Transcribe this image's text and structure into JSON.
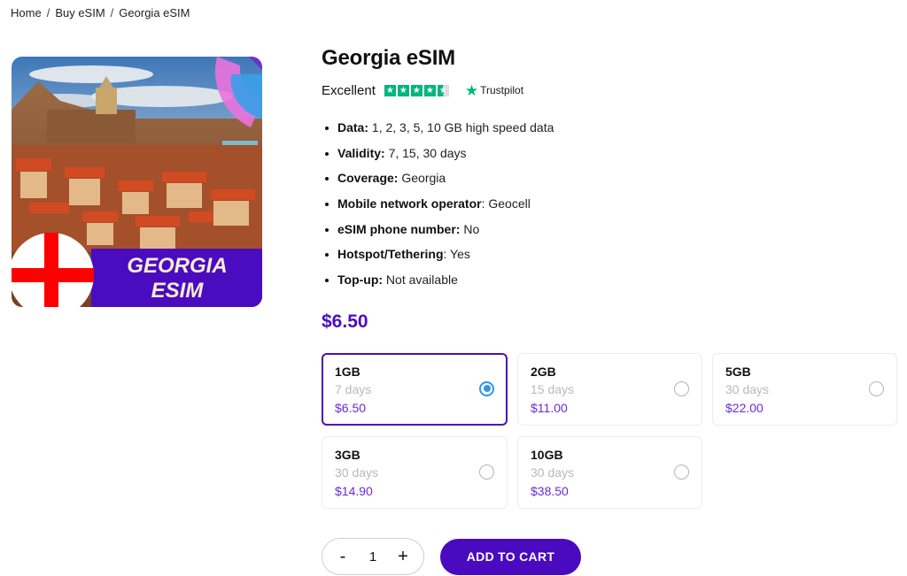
{
  "breadcrumb": {
    "items": [
      "Home",
      "Buy eSIM",
      "Georgia eSIM"
    ],
    "separator": "/"
  },
  "product_image": {
    "alt": "Georgia eSIM",
    "banner_line1": "GEORGIA",
    "banner_line2": "ESIM"
  },
  "product": {
    "title": "Georgia eSIM",
    "rating": {
      "label": "Excellent",
      "stars": 4.5,
      "max_stars": 5,
      "provider": "Trustpilot",
      "provider_icon": "star-icon",
      "color": "#00b67a"
    },
    "features": [
      {
        "label": "Data:",
        "value": " 1, 2, 3, 5, 10 GB high speed data"
      },
      {
        "label": "Validity:",
        "value": " 7, 15, 30 days"
      },
      {
        "label": "Coverage:",
        "value": " Georgia"
      },
      {
        "label": "Mobile network operator",
        "value": ": Geocell"
      },
      {
        "label": "eSIM phone number:",
        "value": " No"
      },
      {
        "label": "Hotspot/Tethering",
        "value": ": Yes"
      },
      {
        "label": "Top-up:",
        "value": " Not available"
      }
    ],
    "price": "$6.50",
    "accent_color": "#4a0fc0"
  },
  "plans": [
    {
      "data": "1GB",
      "validity": "7 days",
      "price": "$6.50",
      "selected": true
    },
    {
      "data": "2GB",
      "validity": "15 days",
      "price": "$11.00",
      "selected": false
    },
    {
      "data": "5GB",
      "validity": "30 days",
      "price": "$22.00",
      "selected": false
    },
    {
      "data": "3GB",
      "validity": "30 days",
      "price": "$14.90",
      "selected": false
    },
    {
      "data": "10GB",
      "validity": "30 days",
      "price": "$38.50",
      "selected": false
    }
  ],
  "cart": {
    "decrement_label": "-",
    "quantity": "1",
    "increment_label": "+",
    "add_to_cart_label": "ADD TO CART"
  }
}
